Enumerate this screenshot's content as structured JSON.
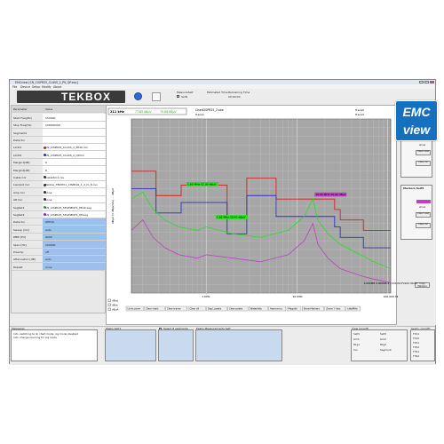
{
  "window": {
    "title": "EMCview [CN_CISPR25_CLASS_2_PK_QP.ecp]",
    "menu": [
      "File",
      "Device",
      "Setup",
      "Modify",
      "About"
    ]
  },
  "toolbar": {
    "logo_text": "TEKBOX",
    "measure_self_label": "MeasureSelf",
    "self_label": "Self1",
    "estimated_time_label": "Estimated Time",
    "remaining_time_label": "Remaining Time",
    "estimated_time_value": "00:00:00"
  },
  "parameters": {
    "header_name": "Parameter",
    "header_value": "Value",
    "rows": [
      {
        "name": "Start Freq(Hz)",
        "value": "150000",
        "color": "",
        "bg": "#ffffff"
      },
      {
        "name": "Stop Freq(Hz)",
        "value": "108000000",
        "color": "",
        "bg": "#ffffff"
      },
      {
        "name": "Segments",
        "value": "",
        "color": "",
        "bg": "#ffffff"
      },
      {
        "name": "Detector",
        "value": "",
        "color": "",
        "bg": "#ffffff"
      },
      {
        "name": "Limit1",
        "value": "CN_CISPR25_CLASS_2_PEAK.lim",
        "color": "#d62020",
        "bg": "#ffffff"
      },
      {
        "name": "Limit2",
        "value": "CN_CISPR25_CLASS_2_QP.lim",
        "color": "#3030c8",
        "bg": "#ffffff"
      },
      {
        "name": "Margin1[dB]",
        "value": "6",
        "color": "",
        "bg": "#ffffff"
      },
      {
        "name": "Margin2[dB]",
        "value": "6",
        "color": "",
        "bg": "#ffffff"
      },
      {
        "name": "Cable Cor",
        "value": "Cable5m1.csv",
        "color": "#333333",
        "bg": "#ffffff"
      },
      {
        "name": "Lisn/Ant Cor",
        "value": "Tekbox_TBOH01_CISPR16_1_2_fo_8.csv",
        "color": "#333333",
        "bg": "#ffffff"
      },
      {
        "name": "Amp Cor",
        "value": "none",
        "color": "#333333",
        "bg": "#ffffff"
      },
      {
        "name": "Att Cor",
        "value": "none",
        "color": "#333333",
        "bg": "#ffffff"
      },
      {
        "name": "SegSet1",
        "value": "CN_CISPR25_SEGMENTS_PEAK.seg",
        "color": "#2a9a2a",
        "bg": "#ffffff"
      },
      {
        "name": "SegSet2",
        "value": "CN_CISPR25_SEGMENTS_QP.seg",
        "color": "#a020c0",
        "bg": "#ffffff"
      },
      {
        "name": "Detector",
        "value": "QPEAK",
        "color": "",
        "bg": "#9cc0ec"
      },
      {
        "name": "Sweep [ms]",
        "value": "auto",
        "color": "",
        "bg": "#9cc0ec"
      },
      {
        "name": "RBW [Hz]",
        "value": "9000",
        "color": "",
        "bg": "#9cc0ec"
      },
      {
        "name": "Span [Hz]",
        "value": "100000",
        "color": "",
        "bg": "#9cc0ec"
      },
      {
        "name": "Preamp",
        "value": "off",
        "color": "",
        "bg": "#9cc0ec"
      },
      {
        "name": "Attenuation [dB]",
        "value": "auto",
        "color": "",
        "bg": "#9cc0ec"
      },
      {
        "name": "Repeat",
        "value": "none",
        "color": "",
        "bg": "#9cc0ec"
      }
    ]
  },
  "chart_header": {
    "freq_readout": "211 kHz",
    "marker1_readout": "77.85 dBµV",
    "marker2_readout": "70.86 dBµV",
    "chart_name_label": "Chart",
    "chart_name": "CISPR25_2.sbe",
    "trace_label": "Trace1",
    "trace2_label": "Trace2",
    "trace3_label": "Trace3"
  },
  "chart_data": {
    "type": "line",
    "xscale": "log",
    "xlim": [
      150000,
      108000000
    ],
    "ylim": [
      0,
      100
    ],
    "ylabel": "dBµV (3 dBµV/div) ... dBµV",
    "xticks": [
      "1 MHz",
      "10 MHz",
      "100.000 MHz"
    ],
    "grid": true,
    "series": [
      {
        "values": [
          [
            150000,
            70
          ],
          [
            280000,
            70
          ],
          [
            280000,
            56
          ],
          [
            530000,
            56
          ],
          [
            530000,
            62
          ],
          [
            1700000,
            62
          ],
          [
            1700000,
            44
          ],
          [
            2800000,
            44
          ],
          [
            2800000,
            66
          ],
          [
            5900000,
            66
          ],
          [
            5900000,
            54
          ],
          [
            26000000,
            54
          ],
          [
            26000000,
            48
          ],
          [
            30000000,
            48
          ],
          [
            30000000,
            42
          ],
          [
            54000000,
            42
          ],
          [
            54000000,
            36
          ],
          [
            108000000,
            36
          ]
        ],
        "color": "#d62020"
      },
      {
        "values": [
          [
            150000,
            60
          ],
          [
            280000,
            60
          ],
          [
            280000,
            46
          ],
          [
            530000,
            46
          ],
          [
            530000,
            52
          ],
          [
            1700000,
            52
          ],
          [
            1700000,
            34
          ],
          [
            2800000,
            34
          ],
          [
            2800000,
            56
          ],
          [
            5900000,
            56
          ],
          [
            5900000,
            44
          ],
          [
            26000000,
            44
          ],
          [
            26000000,
            38
          ],
          [
            30000000,
            38
          ],
          [
            30000000,
            32
          ],
          [
            54000000,
            32
          ],
          [
            54000000,
            26
          ],
          [
            108000000,
            26
          ]
        ],
        "color": "#3030c8"
      },
      {
        "values": [
          [
            150000,
            54
          ],
          [
            200000,
            58
          ],
          [
            260000,
            48
          ],
          [
            350000,
            42
          ],
          [
            500000,
            38
          ],
          [
            800000,
            36
          ],
          [
            1000000,
            38
          ],
          [
            2000000,
            34
          ],
          [
            4000000,
            32
          ],
          [
            8000000,
            36
          ],
          [
            12000000,
            44
          ],
          [
            15000000,
            54
          ],
          [
            17000000,
            42
          ],
          [
            22000000,
            34
          ],
          [
            30000000,
            28
          ],
          [
            50000000,
            22
          ],
          [
            70000000,
            18
          ],
          [
            108000000,
            14
          ]
        ],
        "color": "#27e01f"
      },
      {
        "values": [
          [
            150000,
            36
          ],
          [
            200000,
            42
          ],
          [
            260000,
            32
          ],
          [
            350000,
            26
          ],
          [
            500000,
            22
          ],
          [
            800000,
            20
          ],
          [
            1000000,
            22
          ],
          [
            2000000,
            20
          ],
          [
            4000000,
            18
          ],
          [
            8000000,
            22
          ],
          [
            12000000,
            30
          ],
          [
            15000000,
            40
          ],
          [
            17000000,
            28
          ],
          [
            22000000,
            20
          ],
          [
            30000000,
            14
          ],
          [
            50000000,
            10
          ],
          [
            70000000,
            8
          ],
          [
            108000000,
            6
          ]
        ],
        "color": "#c23cc8"
      }
    ],
    "annotations": [
      {
        "text": "1.60 MHz  52.30 dBµV",
        "x": 620000,
        "y": 62,
        "color": "#27e01f"
      },
      {
        "text": "1.82 MHz  33.40 dBµV",
        "x": 1300000,
        "y": 43,
        "color": "#27e01f"
      },
      {
        "text": "15.00 MHz  49.00 dBµV",
        "x": 16000000,
        "y": 56,
        "color": "#c23cc8"
      }
    ]
  },
  "right_panel": {
    "markers1_title": "Markers Self1",
    "markers2_title": "Markers Self2",
    "show_label": "show",
    "clear_last": "Clear Last",
    "clear_all": "Clear All",
    "copy_markers": "Copy Markers",
    "swatch1": "#27e01f",
    "swatch2": "#c23cc8"
  },
  "chart_toolbar": {
    "options": [
      "dBuv",
      "dBm",
      "dBuA"
    ],
    "buttons": [
      "Undo zoom",
      "Clear chart",
      "Clear traces",
      "Clear all",
      "Dspl. peaks",
      "Clear peaks",
      "Waterfalls",
      "Harmonics",
      "Magnify",
      "Show Markers",
      "Zoom Y Axis",
      "kHz/MHz"
    ]
  },
  "bottom": {
    "messages_label": "Messages",
    "messages": [
      "Info: switching to lin chart mode: log mode disabled",
      "Info: change zooming for log mode"
    ],
    "peaks_self1_label": "Peaks Self1",
    "select_segments_label": "Select 8 segments",
    "peaks_measurements_label": "Peaks Measurements Self",
    "view_label": "View (on/off)",
    "traces_label": "Segm. (on/off)",
    "view_items": [
      "Self1",
      "Self2",
      "Lim1",
      "Lim2",
      "Mrg1",
      "Mrg2",
      "Cor",
      "Segment"
    ],
    "trace_items": [
      "T1S1",
      "T1S2",
      "T2S1",
      "T2S2",
      "T3S1",
      "T3S2"
    ]
  },
  "status": {
    "text": "4.006MB   4.006MB-4 | 104.00 IF2222   00.08"
  },
  "badge": {
    "line1": "EMC",
    "line2": "view"
  }
}
